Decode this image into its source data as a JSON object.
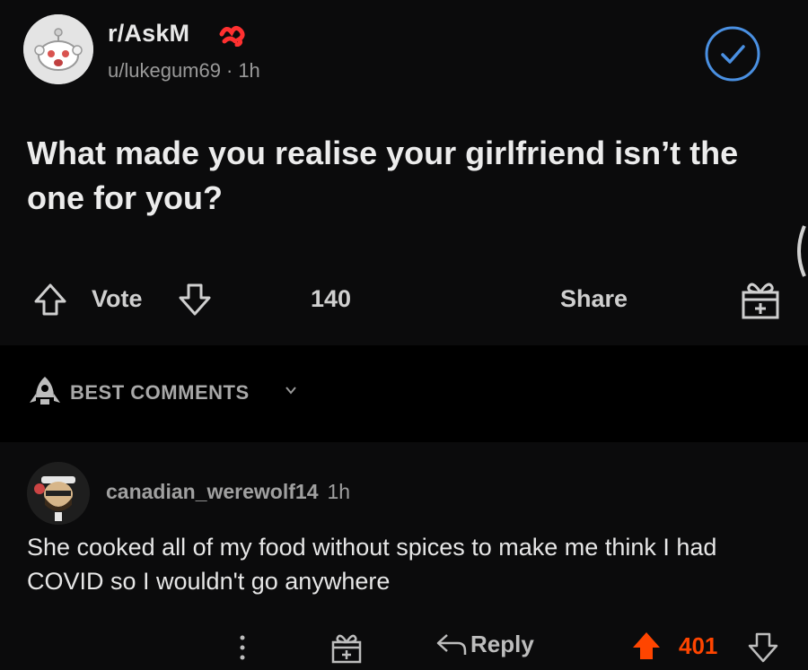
{
  "post": {
    "subreddit": "r/AskM",
    "author": "u/lukegum69",
    "separator": "·",
    "time": "1h",
    "title": "What made you realise your girlfriend isn’t the one for you?",
    "vote_label": "Vote",
    "comments_count": "140",
    "share_label": "Share"
  },
  "comments_section": {
    "sort_label": "BEST COMMENTS"
  },
  "comment": {
    "username": "canadian_werewolf14",
    "time": "1h",
    "body": "She cooked all of my food without spices to make me think I had COVID so I wouldn't go anywhere",
    "reply_label": "Reply",
    "score": "401"
  },
  "colors": {
    "background": "#000000",
    "card": "#0b0b0c",
    "text": "#ececec",
    "muted": "#9a9a9a",
    "upvote": "#ff4500",
    "redaction": "#ff3030",
    "mod_check": "#4a90e2"
  },
  "icons": [
    "snoo-avatar",
    "mod-check-icon",
    "upvote-icon",
    "downvote-icon",
    "award-icon",
    "rocket-icon",
    "chevron-down-icon",
    "more-icon",
    "reply-icon"
  ]
}
